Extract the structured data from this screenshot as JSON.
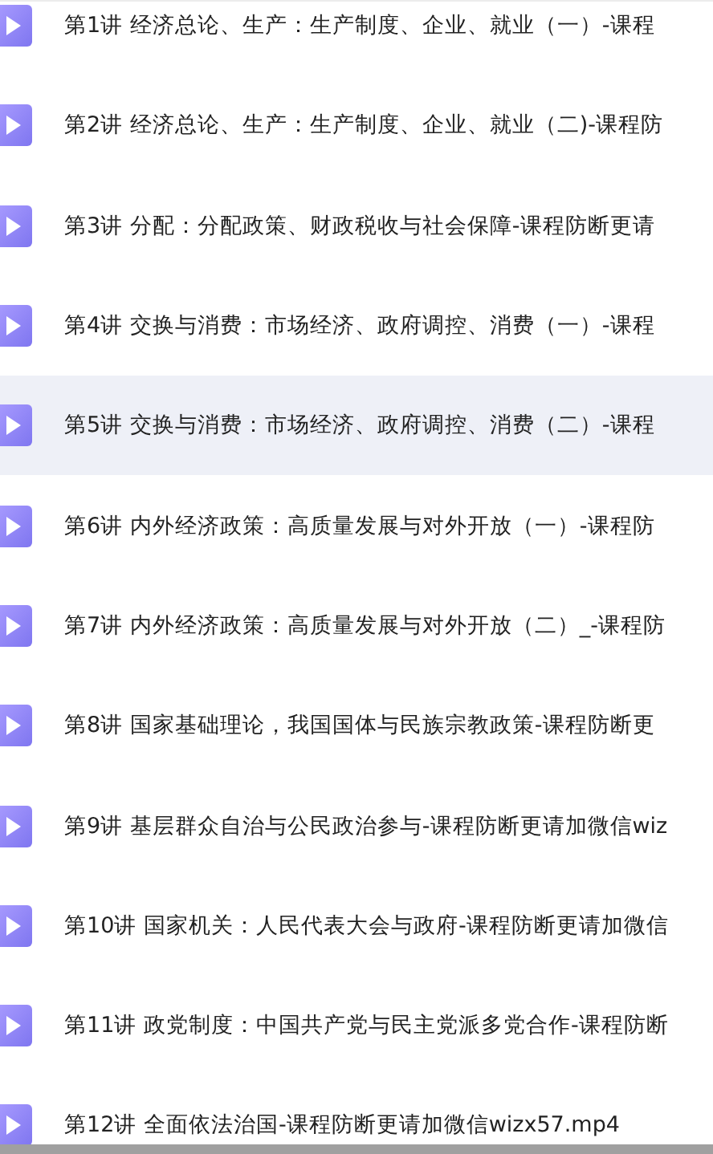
{
  "files": [
    {
      "name": "第1讲 经济总论、生产：生产制度、企业、就业（一）-课程",
      "selected": false
    },
    {
      "name": "第2讲 经济总论、生产：生产制度、企业、就业（二)-课程防",
      "selected": false
    },
    {
      "name": "第3讲 分配：分配政策、财政税收与社会保障-课程防断更请",
      "selected": false
    },
    {
      "name": "第4讲 交换与消费：市场经济、政府调控、消费（一）-课程",
      "selected": false
    },
    {
      "name": "第5讲 交换与消费：市场经济、政府调控、消费（二）-课程",
      "selected": true
    },
    {
      "name": "第6讲 内外经济政策：高质量发展与对外开放（一）-课程防",
      "selected": false
    },
    {
      "name": "第7讲 内外经济政策：高质量发展与对外开放（二）_-课程防",
      "selected": false
    },
    {
      "name": "第8讲 国家基础理论，我国国体与民族宗教政策-课程防断更",
      "selected": false
    },
    {
      "name": "第9讲 基层群众自治与公民政治参与-课程防断更请加微信wiz",
      "selected": false
    },
    {
      "name": "第10讲 国家机关：人民代表大会与政府-课程防断更请加微信",
      "selected": false
    },
    {
      "name": "第11讲 政党制度：中国共产党与民主党派多党合作-课程防断",
      "selected": false
    },
    {
      "name": "第12讲 全面依法治国-课程防断更请加微信wizx57.mp4",
      "selected": false
    }
  ]
}
